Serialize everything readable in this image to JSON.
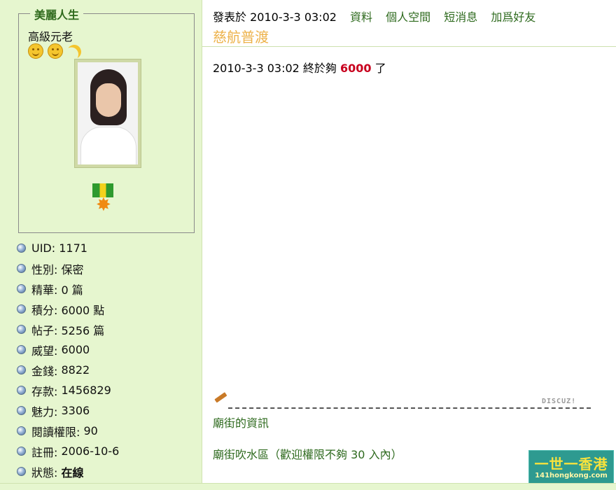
{
  "user": {
    "name": "美麗人生",
    "rank": "高級元老"
  },
  "stats": [
    {
      "label": "UID:",
      "value": "1171"
    },
    {
      "label": "性別:",
      "value": "保密"
    },
    {
      "label": "精華:",
      "value": "0 篇"
    },
    {
      "label": "積分:",
      "value": "6000 點"
    },
    {
      "label": "帖子:",
      "value": "5256 篇"
    },
    {
      "label": "威望:",
      "value": "6000"
    },
    {
      "label": "金錢:",
      "value": "8822"
    },
    {
      "label": "存款:",
      "value": "1456829"
    },
    {
      "label": "魅力:",
      "value": "3306"
    },
    {
      "label": "閱讀權限:",
      "value": "90"
    },
    {
      "label": "註冊:",
      "value": "2006-10-6"
    },
    {
      "label": "狀態:",
      "value": "在線"
    }
  ],
  "post": {
    "posted_label": "發表於",
    "datetime": "2010-3-3 03:02",
    "links": [
      "資料",
      "個人空間",
      "短消息",
      "加爲好友"
    ],
    "title": "慈航普渡",
    "body_prefix": "2010-3-3 03:02  終於夠",
    "body_highlight": "6000",
    "body_suffix": "了"
  },
  "signature": {
    "brand": "DISCUZ!",
    "line1": "廟街的資訊",
    "line2_prefix": "廟街吹水區（歡迎權限不夠",
    "line2_num": "30",
    "line2_suffix": "入內）"
  },
  "watermark": {
    "title": "一世一香港",
    "url": "141hongkong.com"
  },
  "colors": {
    "sidebar_bg": "#E6F6CF",
    "link_green": "#2E6A1E",
    "title_orange": "#EDB24A",
    "highlight_red": "#C8001E"
  }
}
